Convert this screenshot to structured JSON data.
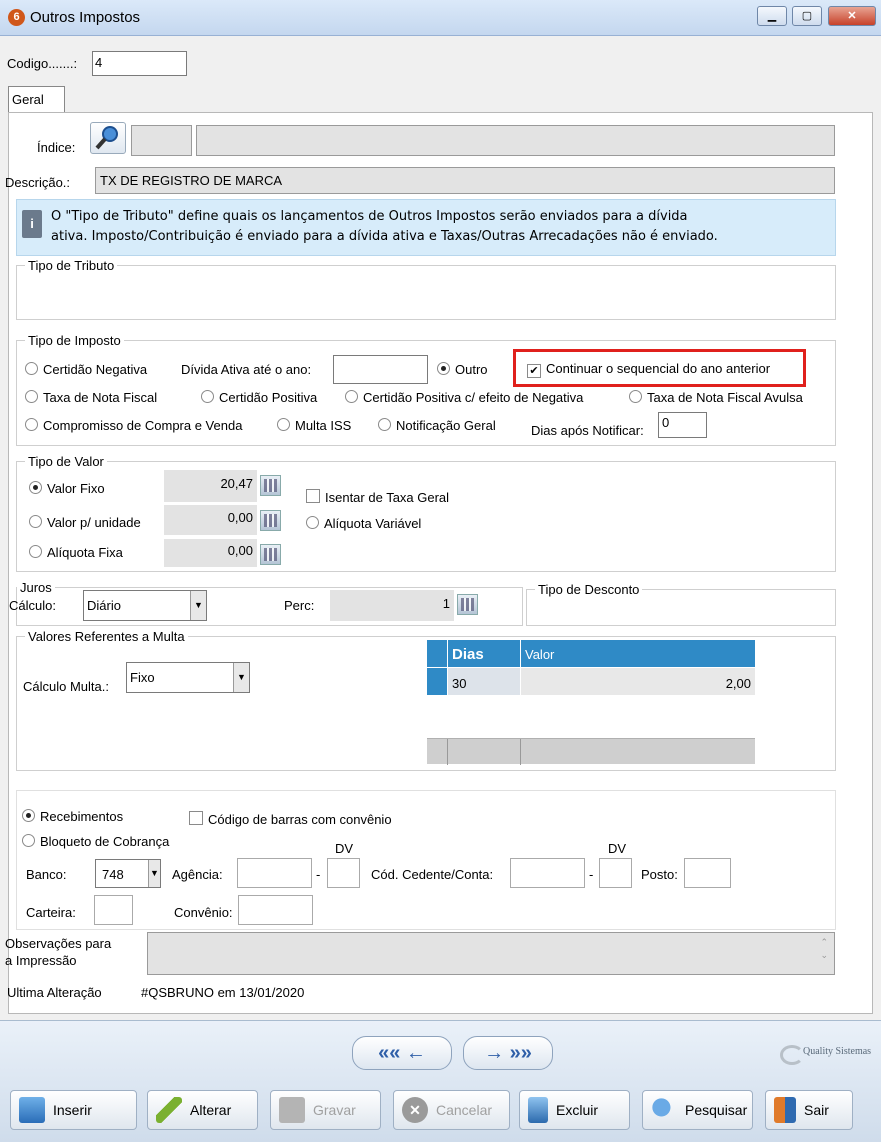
{
  "window": {
    "title": "Outros Impostos",
    "app_icon": "6"
  },
  "codigo": {
    "label": "Codigo.......:",
    "value": "4"
  },
  "tab": {
    "label": "Geral"
  },
  "indice": {
    "label": "Índice:"
  },
  "descricao": {
    "label": "Descrição.:",
    "value": "TX DE REGISTRO DE MARCA"
  },
  "info": {
    "line1": "O \"Tipo de Tributo\" define quais os lançamentos de Outros Impostos serão enviados para a dívida",
    "line2": "ativa. Imposto/Contribuição é enviado para a dívida ativa e Taxas/Outras Arrecadações não é enviado."
  },
  "tipo_tributo": {
    "legend": "Tipo de Tributo"
  },
  "tipo_imposto": {
    "legend": "Tipo de Imposto",
    "certidao_negativa": "Certidão Negativa",
    "divida_ativa_label": "Dívida Ativa até o ano:",
    "outro": "Outro",
    "continuar": "Continuar o sequencial do ano anterior",
    "taxa_nota_fiscal": "Taxa de Nota Fiscal",
    "certidao_positiva": "Certidão Positiva",
    "certidao_positiva_efeito": "Certidão Positiva c/ efeito de Negativa",
    "taxa_nf_avulsa": "Taxa de Nota Fiscal Avulsa",
    "compromisso": "Compromisso de Compra e Venda",
    "multa_iss": "Multa ISS",
    "notificacao_geral": "Notificação Geral",
    "dias_apos_label": "Dias após Notificar:",
    "dias_apos_value": "0"
  },
  "tipo_valor": {
    "legend": "Tipo de Valor",
    "valor_fixo": "Valor Fixo",
    "valor_fixo_value": "20,47",
    "valor_unidade": "Valor p/ unidade",
    "valor_unidade_value": "0,00",
    "aliquota_fixa": "Alíquota Fixa",
    "aliquota_fixa_value": "0,00",
    "isentar": "Isentar de Taxa Geral",
    "aliquota_variavel": "Alíquota Variável"
  },
  "juros": {
    "legend": "Juros",
    "calculo_label": "Cálculo:",
    "calculo_value": "Diário",
    "perc_label": "Perc:",
    "perc_value": "1"
  },
  "tipo_desconto": {
    "legend": "Tipo de Desconto"
  },
  "multa": {
    "legend": "Valores Referentes a Multa",
    "calculo_label": "Cálculo Multa.:",
    "calculo_value": "Fixo",
    "columns": [
      "Dias",
      "Valor"
    ],
    "rows": [
      {
        "dias": "30",
        "valor": "2,00"
      }
    ]
  },
  "cobranca": {
    "recebimentos": "Recebimentos",
    "codigo_barras": "Código de barras com convênio",
    "bloqueto": "Bloqueto de Cobrança",
    "dv1": "DV",
    "dv2": "DV",
    "banco_label": "Banco:",
    "banco_value": "748",
    "agencia_label": "Agência:",
    "dash": "-",
    "cedente_label": "Cód. Cedente/Conta:",
    "posto_label": "Posto:",
    "carteira_label": "Carteira:",
    "convenio_label": "Convênio:"
  },
  "observacoes": {
    "label_line1": "Observações para",
    "label_line2": "a Impressão"
  },
  "ultima_alteracao": {
    "label": "Ultima Alteração",
    "value": "#QSBRUNO em 13/01/2020"
  },
  "nav": {
    "prev": "«« ←",
    "next": "→ »»"
  },
  "brand": {
    "text": "Quality Sistemas"
  },
  "toolbar": {
    "inserir": "Inserir",
    "alterar": "Alterar",
    "gravar": "Gravar",
    "cancelar": "Cancelar",
    "excluir": "Excluir",
    "pesquisar": "Pesquisar",
    "sair": "Sair"
  }
}
